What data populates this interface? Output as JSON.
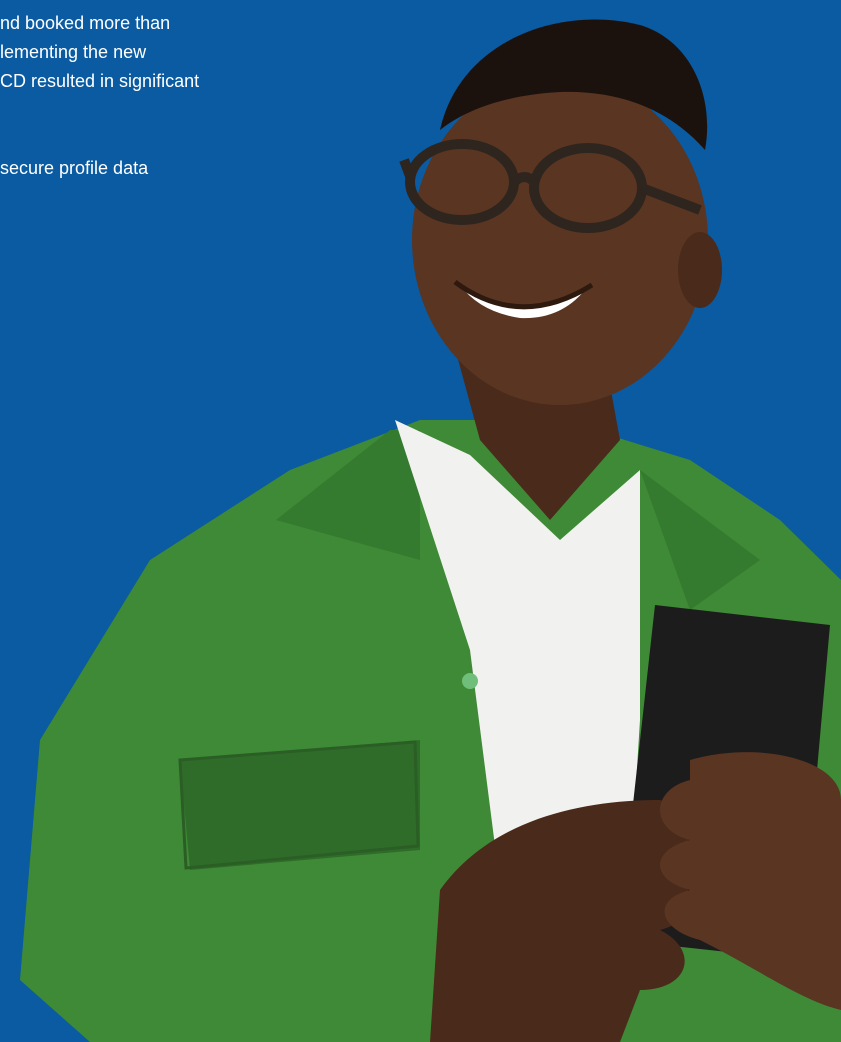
{
  "copy": {
    "line1": "nd booked more than",
    "line2": "lementing the new",
    "line3": "CD resulted in significant",
    "line4": "secure profile data"
  },
  "photo": {
    "subject": "smiling-man-with-phone",
    "colors": {
      "background": "#0a5ba1",
      "jacket": "#3f8a36",
      "jacket_shadow": "#2f6c2a",
      "shirt": "#f1f1ef",
      "skin": "#5a3522",
      "skin_dark": "#3b2114",
      "hair": "#1c120d",
      "glasses": "#2f251f",
      "phone": "#1c1c1c"
    }
  }
}
